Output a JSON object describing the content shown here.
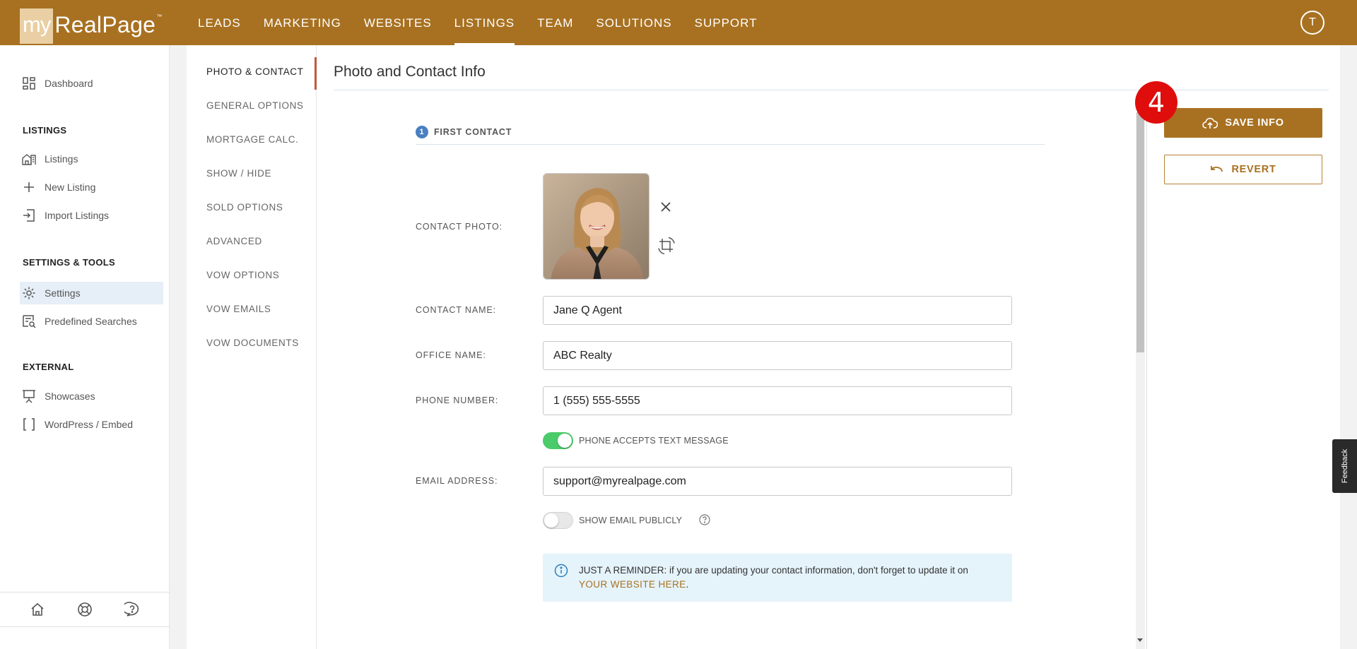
{
  "brand": {
    "logo_my": "my",
    "logo_name": "RealPage",
    "logo_tm": "™"
  },
  "nav": {
    "items": [
      "LEADS",
      "MARKETING",
      "WEBSITES",
      "LISTINGS",
      "TEAM",
      "SOLUTIONS",
      "SUPPORT"
    ],
    "active": "LISTINGS"
  },
  "user": {
    "avatar_initial": "T"
  },
  "sidebar": {
    "dashboard": "Dashboard",
    "listings_section": "LISTINGS",
    "listings": "Listings",
    "new_listing": "New Listing",
    "import_listings": "Import Listings",
    "settings_section": "SETTINGS & TOOLS",
    "settings": "Settings",
    "predefined_searches": "Predefined Searches",
    "external_section": "EXTERNAL",
    "showcases": "Showcases",
    "wordpress_embed": "WordPress / Embed"
  },
  "subnav": {
    "items": [
      "PHOTO & CONTACT",
      "GENERAL OPTIONS",
      "MORTGAGE CALC.",
      "SHOW / HIDE",
      "SOLD OPTIONS",
      "ADVANCED",
      "VOW OPTIONS",
      "VOW EMAILS",
      "VOW DOCUMENTS"
    ],
    "active": "PHOTO & CONTACT"
  },
  "page": {
    "title": "Photo and Contact Info"
  },
  "section": {
    "step": "1",
    "title": "FIRST CONTACT"
  },
  "form": {
    "contact_photo_label": "CONTACT PHOTO:",
    "contact_name_label": "CONTACT NAME:",
    "contact_name_value": "Jane Q Agent",
    "office_name_label": "OFFICE NAME:",
    "office_name_value": "ABC Realty",
    "phone_label": "PHONE NUMBER:",
    "phone_value": "1 (555) 555-5555",
    "phone_text_label": "PHONE ACCEPTS TEXT MESSAGE",
    "phone_text_on": true,
    "email_label": "EMAIL ADDRESS:",
    "email_value": "support@myrealpage.com",
    "show_email_label": "SHOW EMAIL PUBLICLY",
    "show_email_on": false
  },
  "reminder": {
    "text": "JUST A REMINDER: if you are updating your contact information, don't forget to update it on",
    "link": "YOUR WEBSITE HERE",
    "suffix": "."
  },
  "actions": {
    "save": "SAVE INFO",
    "revert": "REVERT"
  },
  "annotation": {
    "badge": "4"
  },
  "feedback": {
    "label": "Feedback"
  },
  "colors": {
    "brand": "#a87121",
    "toggle_on": "#4ccb6a",
    "badge": "#e00d0d",
    "info_bg": "#e5f3fb"
  }
}
